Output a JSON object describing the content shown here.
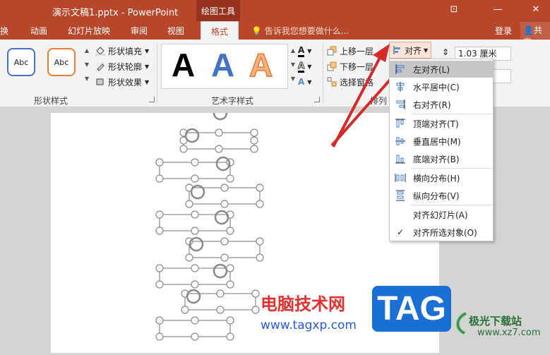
{
  "titlebar": {
    "doc_title": "演示文稿1.pptx - PowerPoint",
    "context_tab_header": "绘图工具",
    "restore_glyph": "⊡",
    "minimize_glyph": "—",
    "close_glyph": "✕"
  },
  "tabs": [
    {
      "label": "换"
    },
    {
      "label": "动画"
    },
    {
      "label": "幻灯片放映"
    },
    {
      "label": "审阅"
    },
    {
      "label": "视图"
    },
    {
      "label": "格式"
    }
  ],
  "tell_me": "告诉我您想要做什么...",
  "login": "登录",
  "share": "共享",
  "ribbon": {
    "shape_styles": {
      "thumb1": "Abc",
      "thumb2": "Abc",
      "fill": "形状填充",
      "outline": "形状轮廓",
      "effects": "形状效果",
      "label": "形状样式"
    },
    "wordart": {
      "letter": "A",
      "label": "艺术字样式"
    },
    "arrange": {
      "bring_forward": "上移一层",
      "send_backward": "下移一层",
      "selection_pane": "选择窗格",
      "align": "对齐",
      "label": "排列"
    },
    "size": {
      "height": "1.03 厘米",
      "width": ""
    }
  },
  "align_menu": {
    "items": [
      {
        "label": "左对齐(L)",
        "icon": "align-left-icon"
      },
      {
        "label": "水平居中(C)",
        "icon": "align-center-icon"
      },
      {
        "label": "右对齐(R)",
        "icon": "align-right-icon"
      },
      {
        "label": "顶端对齐(T)",
        "icon": "align-top-icon"
      },
      {
        "label": "垂直居中(M)",
        "icon": "align-middle-icon"
      },
      {
        "label": "底端对齐(B)",
        "icon": "align-bottom-icon"
      },
      {
        "label": "横向分布(H)",
        "icon": "distribute-horizontal-icon"
      },
      {
        "label": "纵向分布(V)",
        "icon": "distribute-vertical-icon"
      },
      {
        "label": "对齐幻灯片(A)",
        "icon": ""
      },
      {
        "label": "对齐所选对象(O)",
        "icon": "checkmark-icon"
      }
    ]
  },
  "watermark": {
    "site_name": "电脑技术网",
    "site_url": "www.tagxp.com",
    "tag_logo": "TAG",
    "right_brand": "极光下载站",
    "right_url": "www.xz7.com"
  },
  "colors": {
    "accent": "#b7472a",
    "context_tab": "#96321d",
    "arrow": "#d42a2a"
  }
}
